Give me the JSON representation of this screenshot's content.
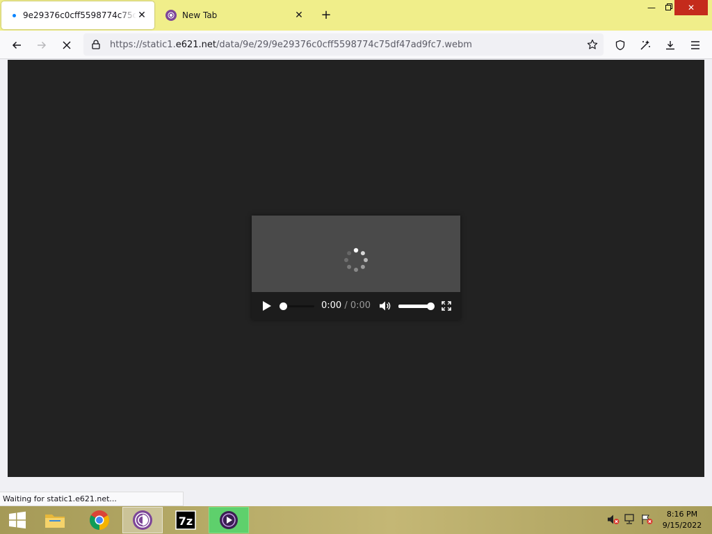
{
  "browser": {
    "tabs": [
      {
        "title": "9e29376c0cff5598774c75df47ad9fc7.webm",
        "active": true
      },
      {
        "title": "New Tab",
        "active": false
      }
    ],
    "url": {
      "scheme": "https://",
      "subdomain": "static1.",
      "host": "e621.net",
      "path": "/data/9e/29/9e29376c0cff5598774c75df47ad9fc7.webm"
    },
    "loading": true
  },
  "video_player": {
    "current_time": "0:00",
    "separator": " / ",
    "duration": "0:00",
    "progress": 0,
    "volume": 1
  },
  "status_bar": {
    "text": "Waiting for static1.e621.net..."
  },
  "taskbar": {
    "apps": [
      "file-explorer",
      "chrome",
      "tor-browser",
      "7-zip",
      "media-player"
    ],
    "clock": {
      "time": "8:16 PM",
      "date": "9/15/2022"
    }
  },
  "colors": {
    "titlebar": "#f0ee8a",
    "close_button": "#c42b1c",
    "page_background": "#222222",
    "active_taskbar_item": "#5ed06c"
  }
}
